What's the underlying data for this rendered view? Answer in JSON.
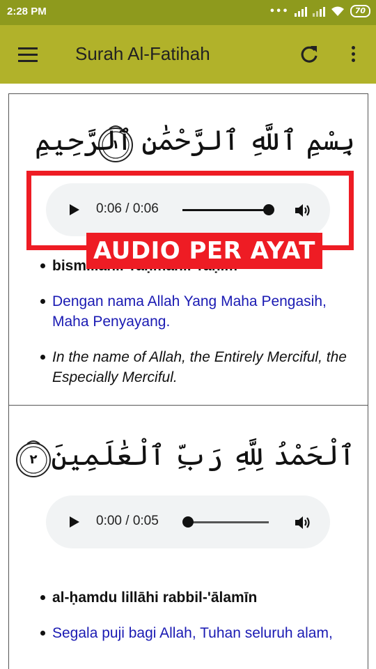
{
  "status_bar": {
    "time": "2:28 PM",
    "battery": "70"
  },
  "app_bar": {
    "title": "Surah Al-Fatihah",
    "icons": [
      "menu-icon",
      "refresh-icon",
      "more-vert-icon"
    ]
  },
  "ayat": [
    {
      "number": "١",
      "arabic": "بِسْمِ ٱللَّهِ ٱلرَّحْمَٰنِ ٱلرَّحِيمِ",
      "audio": {
        "time_display": "0:06 / 0:06",
        "progress": 1.0
      },
      "transliteration": "bismillāhir-raḥmānir-raḥīm",
      "translation_id": "Dengan nama Allah Yang Maha Pengasih, Maha Penyayang.",
      "translation_en": "In the name of Allah, the Entirely Merciful, the Especially Merciful."
    },
    {
      "number": "٢",
      "arabic": "ٱلْحَمْدُ لِلَّهِ رَبِّ ٱلْعَٰلَمِينَ",
      "audio": {
        "time_display": "0:00 / 0:05",
        "progress": 0.0
      },
      "transliteration": "al-ḥamdu lillāhi rabbil-'ālamīn",
      "translation_id": "Segala puji bagi Allah, Tuhan seluruh alam,"
    }
  ],
  "annotation": {
    "label": "AUDIO PER AYAT",
    "color": "#ee1c24"
  },
  "colors": {
    "status_bar": "#8e9a1d",
    "app_bar": "#b1b22a",
    "translation_link": "#1a1ab3"
  }
}
